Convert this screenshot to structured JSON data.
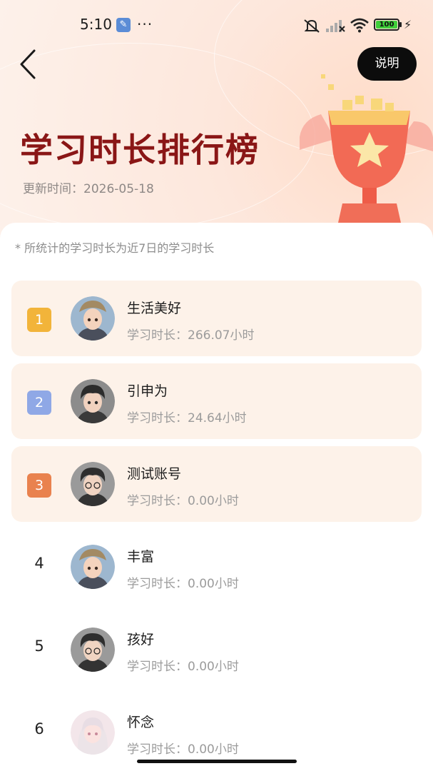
{
  "status_bar": {
    "time": "5:10",
    "more": "···",
    "battery": "100"
  },
  "header": {
    "help_label": "说明",
    "title": "学习时长排行榜",
    "update_time": "更新时间：2026-05-18"
  },
  "note": "* 所统计的学习时长为近7日的学习时长",
  "ranking": [
    {
      "rank": "1",
      "name": "生活美好",
      "duration": "学习时长：266.07小时"
    },
    {
      "rank": "2",
      "name": "引申为",
      "duration": "学习时长：24.64小时"
    },
    {
      "rank": "3",
      "name": "测试账号",
      "duration": "学习时长：0.00小时"
    },
    {
      "rank": "4",
      "name": "丰富",
      "duration": "学习时长：0.00小时"
    },
    {
      "rank": "5",
      "name": "孩好",
      "duration": "学习时长：0.00小时"
    },
    {
      "rank": "6",
      "name": "怀念",
      "duration": "学习时长：0.00小时"
    }
  ],
  "colors": {
    "rank_1": "#f2b43a",
    "rank_2": "#8fa8e6",
    "rank_3": "#e9824e",
    "title": "#8a1616"
  }
}
